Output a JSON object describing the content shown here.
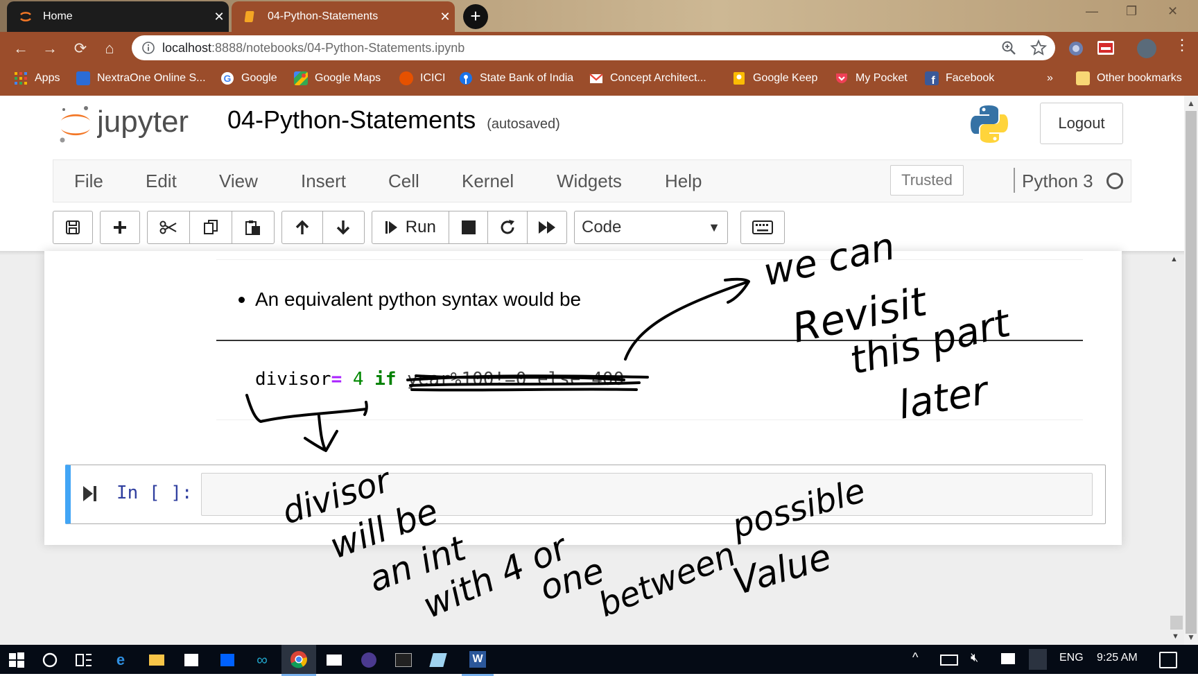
{
  "browser": {
    "tabs": [
      {
        "label": "Home",
        "close": "✕",
        "active": false
      },
      {
        "label": "04-Python-Statements",
        "close": "✕",
        "active": true
      }
    ],
    "new_tab": "+",
    "window_controls": {
      "minimize": "—",
      "restore": "❐",
      "close": "✕"
    },
    "nav": {
      "back": "←",
      "forward": "→",
      "reload": "⟳",
      "home": "⌂"
    },
    "url": {
      "host": "localhost",
      "path": ":8888/notebooks/04-Python-Statements.ipynb"
    },
    "bookmarks": [
      {
        "label": "Apps",
        "icon": "apps-grid-icon",
        "color": "#f4b400"
      },
      {
        "label": "NextraOne Online S...",
        "icon": "nextraone-icon",
        "color": "#2b6cd6"
      },
      {
        "label": "Google",
        "icon": "google-icon",
        "color": "#ffffff"
      },
      {
        "label": "Google Maps",
        "icon": "google-maps-icon",
        "color": "#34a853"
      },
      {
        "label": "ICICI",
        "icon": "icici-icon",
        "color": "#e65100"
      },
      {
        "label": "State Bank of India",
        "icon": "sbi-icon",
        "color": "#1a73e8"
      },
      {
        "label": "Concept Architect...",
        "icon": "gmail-icon",
        "color": "#ffffff"
      },
      {
        "label": "Google Keep",
        "icon": "google-keep-icon",
        "color": "#fbbc04"
      },
      {
        "label": "My Pocket",
        "icon": "pocket-icon",
        "color": "#ef4056"
      },
      {
        "label": "Facebook",
        "icon": "facebook-icon",
        "color": "#3b5998"
      },
      {
        "label": "»",
        "icon": "",
        "color": ""
      },
      {
        "label": "Other bookmarks",
        "icon": "folder-icon",
        "color": "#f8d775"
      }
    ]
  },
  "jupyter": {
    "logo_text": "jupyter",
    "notebook_name": "04-Python-Statements",
    "save_status": "(autosaved)",
    "logout": "Logout",
    "menu": [
      "File",
      "Edit",
      "View",
      "Insert",
      "Cell",
      "Kernel",
      "Widgets",
      "Help"
    ],
    "trusted": "Trusted",
    "kernel": "Python 3",
    "toolbar": {
      "run_label": "Run",
      "cell_type": "Code"
    }
  },
  "notebook": {
    "bullet": "An equivalent python syntax would be",
    "code": {
      "var": "divisor",
      "op": "=",
      "num": " 4 ",
      "kw": "if",
      "rest": " year%100!=0 else 400"
    },
    "prompt": "In [ ]:"
  },
  "annotations": [
    "we can Revisit this part later",
    "divisor will be an int with 4 or one between possible value"
  ],
  "taskbar": {
    "lang": "ENG",
    "time": "9:25 AM"
  },
  "colors": {
    "browser_frame": "#9b4d2b",
    "cell_selected": "#42a5f5",
    "jupyter_orange": "#f37726"
  }
}
